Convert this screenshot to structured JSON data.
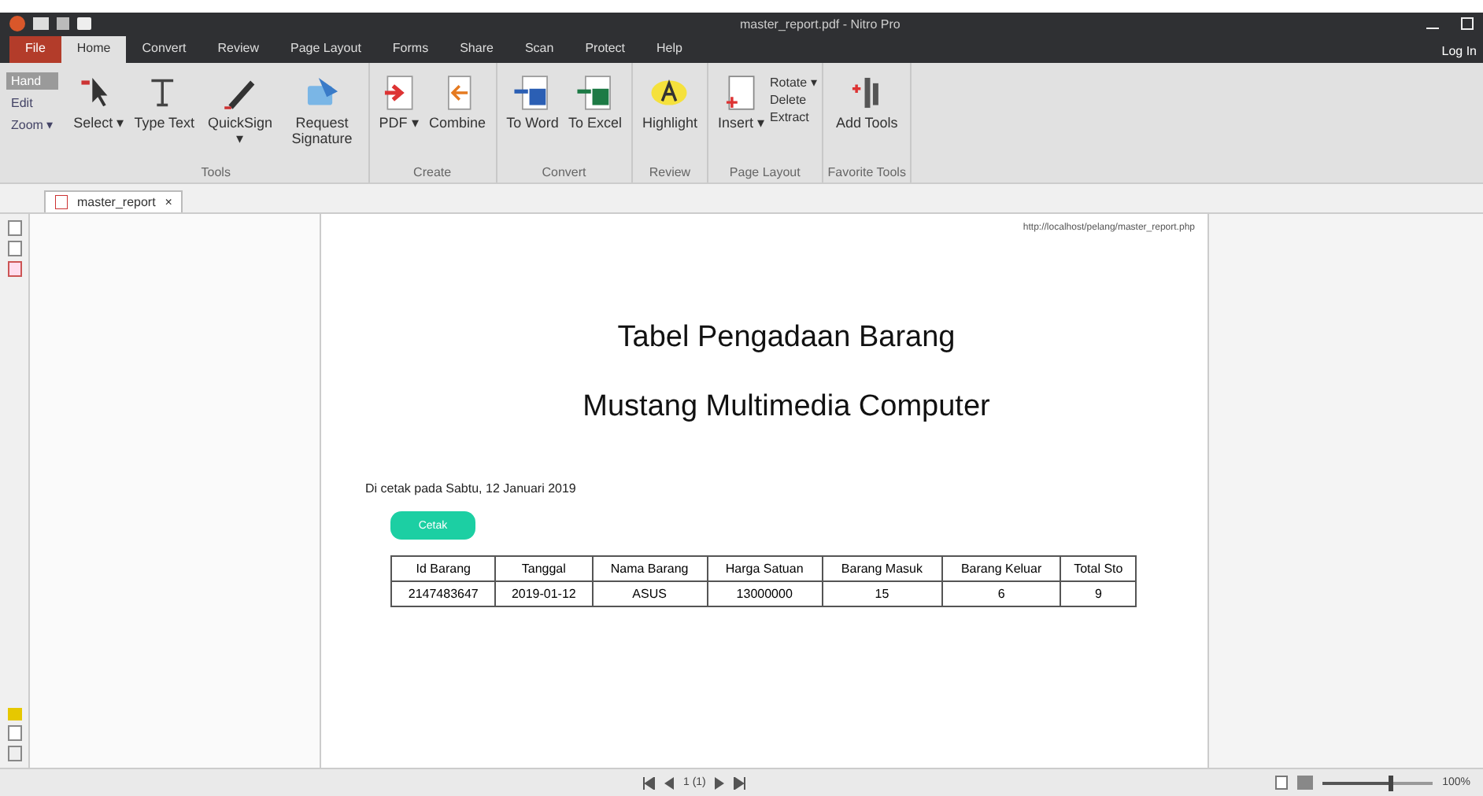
{
  "window": {
    "title": "master_report.pdf - Nitro Pro",
    "login": "Log In"
  },
  "menu_tabs": [
    {
      "label": "File",
      "selected": false,
      "kind": "file"
    },
    {
      "label": "Home",
      "selected": true,
      "kind": "tab"
    },
    {
      "label": "Convert",
      "selected": false,
      "kind": "tab"
    },
    {
      "label": "Review",
      "selected": false,
      "kind": "tab"
    },
    {
      "label": "Page Layout",
      "selected": false,
      "kind": "tab"
    },
    {
      "label": "Forms",
      "selected": false,
      "kind": "tab"
    },
    {
      "label": "Share",
      "selected": false,
      "kind": "tab"
    },
    {
      "label": "Scan",
      "selected": false,
      "kind": "tab"
    },
    {
      "label": "Protect",
      "selected": false,
      "kind": "tab"
    },
    {
      "label": "Help",
      "selected": false,
      "kind": "tab"
    }
  ],
  "modes": [
    {
      "label": "Hand",
      "selected": true
    },
    {
      "label": "Edit",
      "selected": false
    },
    {
      "label": "Zoom ▾",
      "selected": false
    }
  ],
  "ribbon_groups": [
    {
      "label": "Tools",
      "buttons": [
        {
          "label": "Select ▾",
          "kind": "cursor"
        },
        {
          "label": "Type Text",
          "kind": "text"
        },
        {
          "label": "QuickSign ▾",
          "kind": "pen"
        },
        {
          "label": "Request Signature",
          "kind": "sign"
        }
      ]
    },
    {
      "label": "Create",
      "buttons": [
        {
          "label": "PDF ▾",
          "kind": "pdf"
        },
        {
          "label": "Combine",
          "kind": "combine"
        }
      ]
    },
    {
      "label": "Convert",
      "buttons": [
        {
          "label": "To Word",
          "kind": "word"
        },
        {
          "label": "To Excel",
          "kind": "excel"
        }
      ]
    },
    {
      "label": "Review",
      "buttons": [
        {
          "label": "Highlight",
          "kind": "highlight"
        }
      ]
    },
    {
      "label": "Page Layout",
      "buttons": [
        {
          "label": "Insert ▾",
          "kind": "insert"
        }
      ],
      "small": [
        "Rotate ▾",
        "Delete",
        "Extract"
      ]
    },
    {
      "label": "Favorite Tools",
      "buttons": [
        {
          "label": "Add Tools",
          "kind": "add"
        }
      ]
    }
  ],
  "document_tab": {
    "label": "master_report",
    "close": "×"
  },
  "page": {
    "url": "http://localhost/pelang/master_report.php",
    "title": "Tabel Pengadaan Barang",
    "subtitle": "Mustang Multimedia Computer",
    "printed_on": "Di cetak pada Sabtu, 12 Januari 2019",
    "print_button": "Cetak",
    "table": {
      "columns": [
        "Id Barang",
        "Tanggal",
        "Nama Barang",
        "Harga Satuan",
        "Barang Masuk",
        "Barang Keluar",
        "Total Sto"
      ],
      "rows": [
        [
          "2147483647",
          "2019-01-12",
          "ASUS",
          "13000000",
          "15",
          "6",
          "9"
        ]
      ]
    }
  },
  "status_bar": {
    "page": "1 (1)",
    "zoom": "100%",
    "zoom_slider": {
      "level": 0.6
    }
  }
}
